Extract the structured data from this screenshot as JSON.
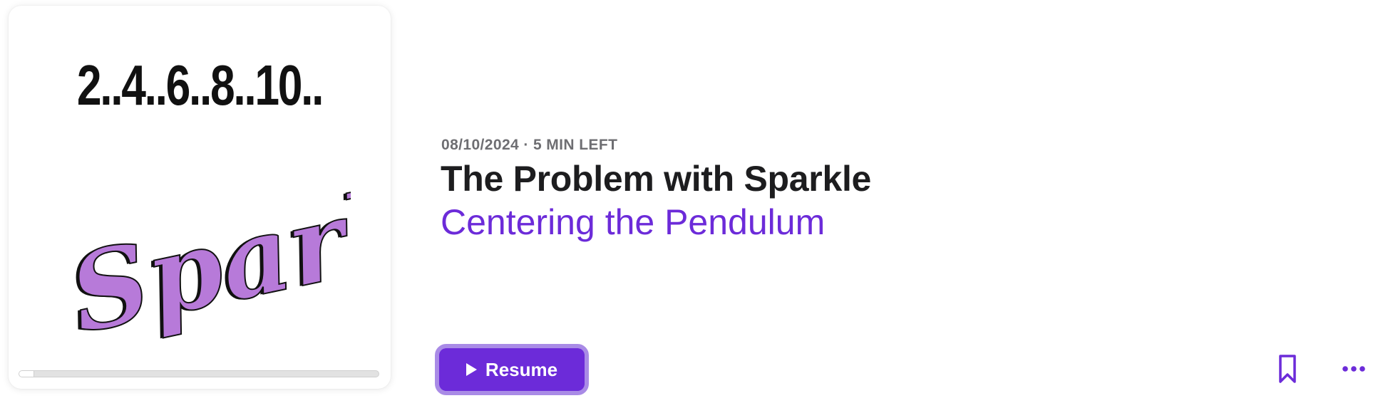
{
  "episode": {
    "artwork": {
      "numbers_text": "2..4..6..8..10..",
      "script_text": "Sparkle",
      "script_color": "#b77ad9"
    },
    "playback_progress": 0.04,
    "meta": "08/10/2024 · 5 MIN LEFT",
    "title": "The Problem with Sparkle",
    "show_name": "Centering the Pendulum"
  },
  "actions": {
    "resume_label": "Resume",
    "play_icon": "play-icon",
    "bookmark_icon": "bookmark-icon",
    "more_icon": "more-icon"
  },
  "colors": {
    "accent": "#6c2bd9",
    "accent_ring": "#a98be6",
    "title": "#1d1d1f",
    "meta": "#6e6e72"
  }
}
